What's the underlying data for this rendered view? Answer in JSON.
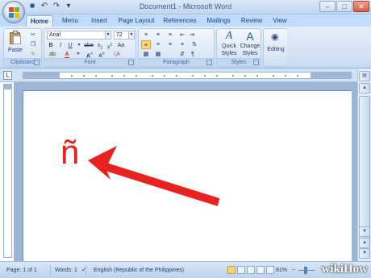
{
  "window": {
    "title": "Document1 - Microsoft Word",
    "controls": [
      "–",
      "□",
      "✕"
    ]
  },
  "quick_access": [
    "save-icon",
    "undo-icon",
    "redo-icon",
    "customize-icon"
  ],
  "tabs": [
    {
      "label": "Home",
      "active": true
    },
    {
      "label": "Menu"
    },
    {
      "label": "Insert"
    },
    {
      "label": "Page Layout"
    },
    {
      "label": "References"
    },
    {
      "label": "Mailings"
    },
    {
      "label": "Review"
    },
    {
      "label": "View"
    }
  ],
  "ribbon": {
    "clipboard": {
      "label": "Clipboard",
      "paste": "Paste"
    },
    "font": {
      "label": "Font",
      "family": "Arial",
      "size": "72"
    },
    "paragraph": {
      "label": "Paragraph"
    },
    "styles": {
      "label": "Styles",
      "quick": "Quick",
      "quick2": "Styles",
      "change": "Change",
      "change2": "Styles"
    },
    "editing": {
      "label": "Editing"
    }
  },
  "document": {
    "text": "ñ",
    "text_color": "#e8231f",
    "annotation": "arrow pointing to the ñ character"
  },
  "status": {
    "page": "Page: 1 of 1",
    "words": "Words: 1",
    "language": "English (Republic of the Philippines)",
    "zoom": "81%"
  },
  "watermark": "wikiHow"
}
